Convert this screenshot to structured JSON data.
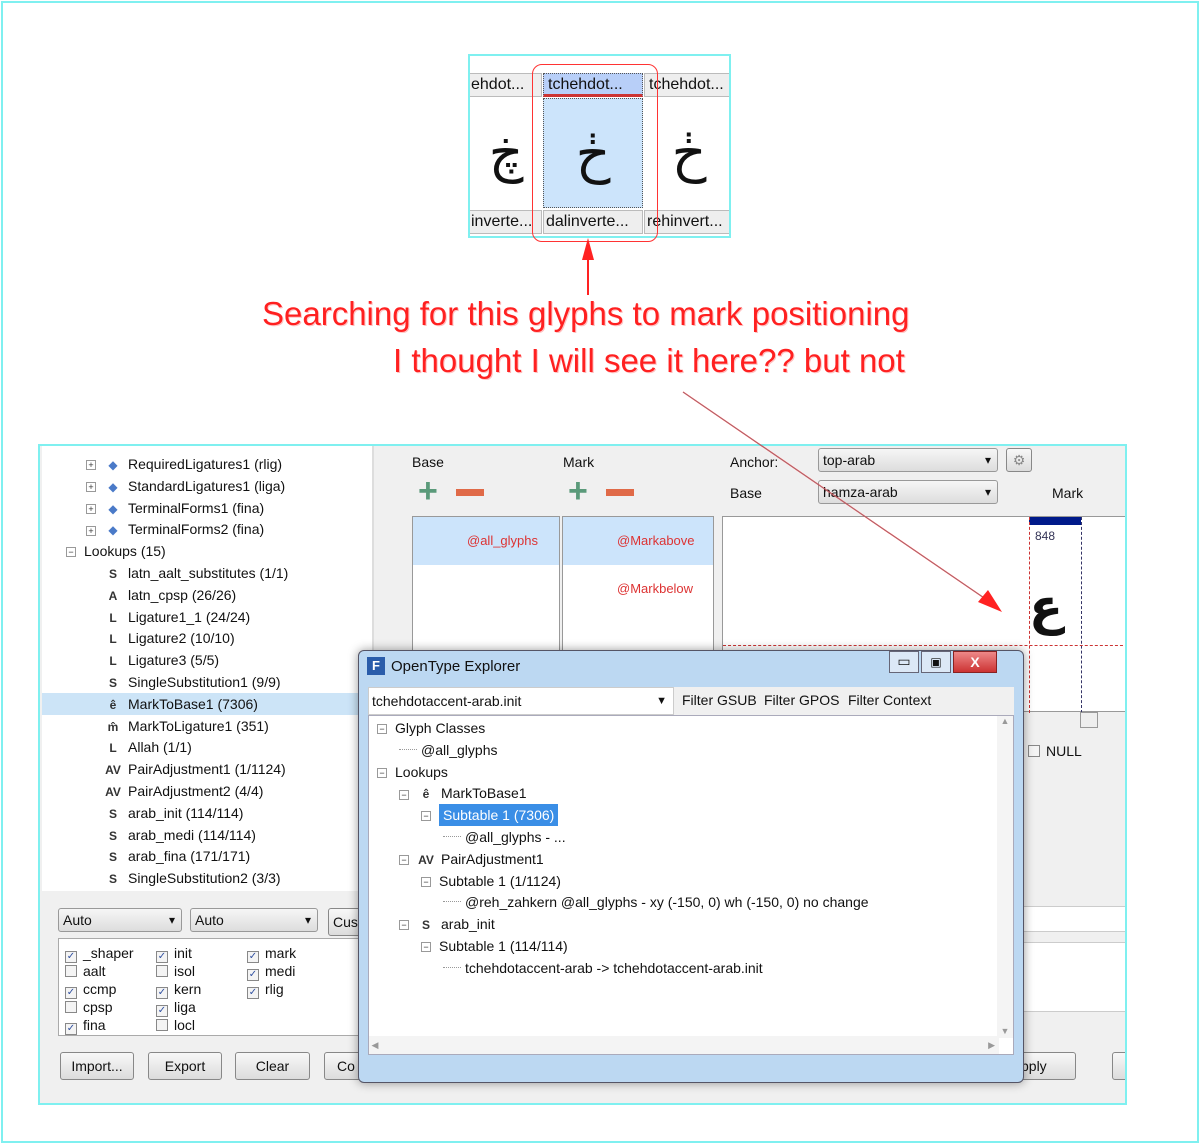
{
  "glyph_strip": {
    "columns": [
      {
        "header": "ehdot...",
        "glyph": "ڿ",
        "footer": "inverte..."
      },
      {
        "header": "tchehdot...",
        "glyph": "ڂ",
        "footer": "dalinverte...",
        "selected": true
      },
      {
        "header": "tchehdot...",
        "glyph": "ڂ",
        "footer": "rehinvert..."
      }
    ]
  },
  "annotation": {
    "line1": "Searching for this glyphs to mark positioning",
    "line2": "I thought I will see it here?? but not",
    "color": "#ff2020"
  },
  "left_tree": {
    "features": [
      "RequiredLigatures1 (rlig)",
      "StandardLigatures1 (liga)",
      "TerminalForms1 (fina)",
      "TerminalForms2 (fina)"
    ],
    "lookups_label": "Lookups (15)",
    "lookups": [
      {
        "icon": "S",
        "label": "latn_aalt_substitutes (1/1)"
      },
      {
        "icon": "A",
        "label": "latn_cpsp (26/26)"
      },
      {
        "icon": "L",
        "label": "Ligature1_1 (24/24)"
      },
      {
        "icon": "L",
        "label": "Ligature2 (10/10)"
      },
      {
        "icon": "L",
        "label": "Ligature3 (5/5)"
      },
      {
        "icon": "S",
        "label": "SingleSubstitution1 (9/9)"
      },
      {
        "icon": "ê",
        "label": "MarkToBase1 (7306)",
        "selected": true
      },
      {
        "icon": "m̂",
        "label": "MarkToLigature1 (351)"
      },
      {
        "icon": "L",
        "label": "Allah (1/1)"
      },
      {
        "icon": "AV",
        "label": "PairAdjustment1 (1/1124)"
      },
      {
        "icon": "AV",
        "label": "PairAdjustment2 (4/4)"
      },
      {
        "icon": "S",
        "label": "arab_init (114/114)"
      },
      {
        "icon": "S",
        "label": "arab_medi (114/114)"
      },
      {
        "icon": "S",
        "label": "arab_fina (171/171)"
      },
      {
        "icon": "S",
        "label": "SingleSubstitution2 (3/3)"
      }
    ]
  },
  "controls": {
    "combo1": "Auto",
    "combo2": "Auto",
    "custom": "Cus",
    "features": [
      {
        "label": "_shaper",
        "checked": true
      },
      {
        "label": "aalt",
        "checked": false
      },
      {
        "label": "ccmp",
        "checked": true
      },
      {
        "label": "cpsp",
        "checked": false
      },
      {
        "label": "fina",
        "checked": true
      },
      {
        "label": "init",
        "checked": true
      },
      {
        "label": "isol",
        "checked": false
      },
      {
        "label": "kern",
        "checked": true
      },
      {
        "label": "liga",
        "checked": true
      },
      {
        "label": "locl",
        "checked": false
      },
      {
        "label": "mark",
        "checked": true
      },
      {
        "label": "medi",
        "checked": true
      },
      {
        "label": "rlig",
        "checked": true
      }
    ],
    "import": "Import...",
    "export": "Export",
    "clear": "Clear",
    "co": "Co",
    "apply": "pply"
  },
  "mark_panel": {
    "base_label": "Base",
    "mark_label": "Mark",
    "anchor_label": "Anchor:",
    "anchor_value": "top-arab",
    "base_combo_label": "Base",
    "base_value": "hamza-arab",
    "mark_header": "Mark",
    "base_items": [
      "@all_glyphs"
    ],
    "mark_items": [
      "@Markabove",
      "@Markbelow"
    ],
    "advance": "848",
    "null_label": "NULL"
  },
  "dialog": {
    "title": "OpenType Explorer",
    "glyph": "tchehdotaccent-arab.init",
    "filters": [
      "Filter GSUB",
      "Filter GPOS",
      "Filter Context"
    ],
    "tree": [
      {
        "level": 0,
        "label": "Glyph Classes",
        "expander": "⊟"
      },
      {
        "level": 1,
        "label": "@all_glyphs"
      },
      {
        "level": 0,
        "label": "Lookups",
        "expander": "⊟"
      },
      {
        "level": 1,
        "label": "MarkToBase1",
        "icon": "ê",
        "expander": "⊟"
      },
      {
        "level": 2,
        "label": "Subtable 1 (7306)",
        "expander": "⊟",
        "selected": true
      },
      {
        "level": 3,
        "label": "@all_glyphs - ..."
      },
      {
        "level": 1,
        "label": "PairAdjustment1",
        "icon": "AV",
        "expander": "⊟"
      },
      {
        "level": 2,
        "label": "Subtable 1 (1/1124)",
        "expander": "⊟"
      },
      {
        "level": 3,
        "label": "@reh_zahkern @all_glyphs - xy (-150, 0) wh (-150, 0) no change"
      },
      {
        "level": 1,
        "label": "arab_init",
        "icon": "S",
        "expander": "⊟"
      },
      {
        "level": 2,
        "label": "Subtable 1 (114/114)",
        "expander": "⊟"
      },
      {
        "level": 3,
        "label": "tchehdotaccent-arab -> tchehdotaccent-arab.init"
      }
    ]
  }
}
